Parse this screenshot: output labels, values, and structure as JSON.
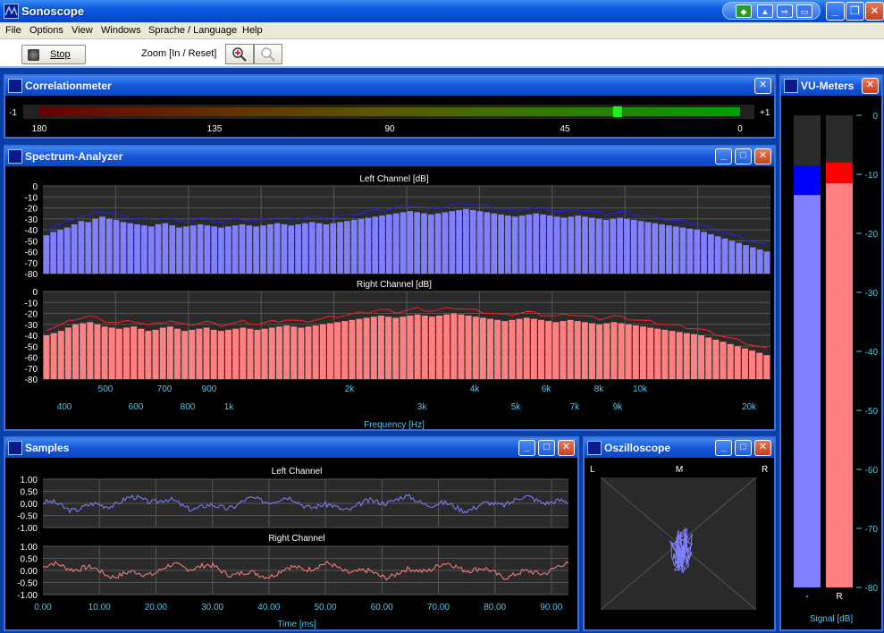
{
  "app": {
    "title": "Sonoscope"
  },
  "menu": [
    "File",
    "Options",
    "View",
    "Windows",
    "Sprache / Language",
    "Help"
  ],
  "toolbar": {
    "stop_label": "Stop",
    "zoom_label": "Zoom [In / Reset]"
  },
  "correlation": {
    "title": "Correlationmeter",
    "left_label": "-1",
    "right_label": "+1",
    "ticks": [
      "180",
      "135",
      "90",
      "45",
      "0"
    ],
    "value": 0.65,
    "colors": {
      "low": "#6a0000",
      "high": "#00b000",
      "marker": "#20f020"
    }
  },
  "spectrum": {
    "title": "Spectrum-Analyzer",
    "left_title": "Left Channel [dB]",
    "right_title": "Right Channel [dB]",
    "y_ticks": [
      "0",
      "-10",
      "-20",
      "-30",
      "-40",
      "-50",
      "-60",
      "-70",
      "-80"
    ],
    "x_labels_top": [
      "500",
      "700",
      "900",
      "2k",
      "4k",
      "6k",
      "8k",
      "10k"
    ],
    "x_labels_bottom": [
      "400",
      "600",
      "800",
      "1k",
      "3k",
      "5k",
      "7k",
      "9k",
      "20k"
    ],
    "xlabel": "Frequency [Hz]",
    "colors": {
      "left": "#8080ff",
      "right": "#ff8080"
    }
  },
  "samples": {
    "title": "Samples",
    "left_title": "Left Channel",
    "right_title": "Right Channel",
    "y_ticks": [
      "1.00",
      "0.50",
      "0.00",
      "-0.50",
      "-1.00"
    ],
    "x_ticks": [
      "0.00",
      "10.00",
      "20.00",
      "30.00",
      "40.00",
      "50.00",
      "60.00",
      "70.00",
      "80.00",
      "90.00"
    ],
    "xlabel": "Time [ms]"
  },
  "oscilloscope": {
    "title": "Oszilloscope",
    "labels": {
      "l": "L",
      "m": "M",
      "r": "R"
    }
  },
  "vu": {
    "title": "VU-Meters",
    "ticks": [
      "0",
      "-10",
      "-20",
      "-30",
      "-40",
      "-50",
      "-60",
      "-70",
      "-80"
    ],
    "left": {
      "label": "-",
      "level_db": -13.5,
      "peak_db": -8.5,
      "color": "#8080ff",
      "peak_color": "#0000ff"
    },
    "right": {
      "label": "R",
      "level_db": -11.5,
      "peak_db": -8,
      "color": "#ff8080",
      "peak_color": "#ff0000"
    },
    "xlabel": "Signal [dB]"
  },
  "chart_data": [
    {
      "type": "bar",
      "title": "Left Channel [dB]",
      "xlabel": "Frequency [Hz]",
      "ylim": [
        -80,
        0
      ],
      "values": [
        -45,
        -42,
        -40,
        -38,
        -35,
        -32,
        -33,
        -30,
        -28,
        -30,
        -31,
        -33,
        -34,
        -35,
        -36,
        -37,
        -35,
        -34,
        -36,
        -38,
        -37,
        -36,
        -35,
        -36,
        -37,
        -38,
        -37,
        -36,
        -35,
        -36,
        -37,
        -36,
        -35,
        -34,
        -35,
        -36,
        -35,
        -34,
        -33,
        -34,
        -35,
        -34,
        -33,
        -32,
        -31,
        -30,
        -29,
        -28,
        -27,
        -26,
        -25,
        -24,
        -23,
        -24,
        -25,
        -26,
        -25,
        -24,
        -23,
        -22,
        -21,
        -22,
        -23,
        -24,
        -25,
        -26,
        -27,
        -28,
        -27,
        -26,
        -25,
        -26,
        -27,
        -28,
        -29,
        -28,
        -27,
        -28,
        -29,
        -30,
        -31,
        -30,
        -29,
        -30,
        -31,
        -32,
        -33,
        -34,
        -35,
        -36,
        -37,
        -38,
        -39,
        -40,
        -42,
        -44,
        -46,
        -48,
        -50,
        -52,
        -54,
        -56,
        -58,
        -60
      ]
    },
    {
      "type": "bar",
      "title": "Right Channel [dB]",
      "xlabel": "Frequency [Hz]",
      "ylim": [
        -80,
        0
      ],
      "values": [
        -40,
        -38,
        -36,
        -33,
        -30,
        -29,
        -28,
        -30,
        -32,
        -33,
        -34,
        -33,
        -32,
        -34,
        -36,
        -35,
        -33,
        -32,
        -34,
        -36,
        -35,
        -34,
        -33,
        -35,
        -36,
        -35,
        -34,
        -33,
        -34,
        -35,
        -34,
        -33,
        -32,
        -31,
        -32,
        -33,
        -32,
        -31,
        -30,
        -29,
        -28,
        -27,
        -26,
        -25,
        -24,
        -23,
        -22,
        -23,
        -24,
        -23,
        -22,
        -21,
        -22,
        -23,
        -22,
        -21,
        -20,
        -21,
        -22,
        -23,
        -24,
        -25,
        -26,
        -27,
        -26,
        -25,
        -24,
        -25,
        -26,
        -27,
        -28,
        -27,
        -26,
        -27,
        -28,
        -29,
        -30,
        -29,
        -28,
        -29,
        -30,
        -31,
        -32,
        -33,
        -34,
        -35,
        -36,
        -37,
        -38,
        -39,
        -40,
        -42,
        -44,
        -46,
        -48,
        -50,
        -52,
        -54,
        -56,
        -58
      ]
    }
  ]
}
